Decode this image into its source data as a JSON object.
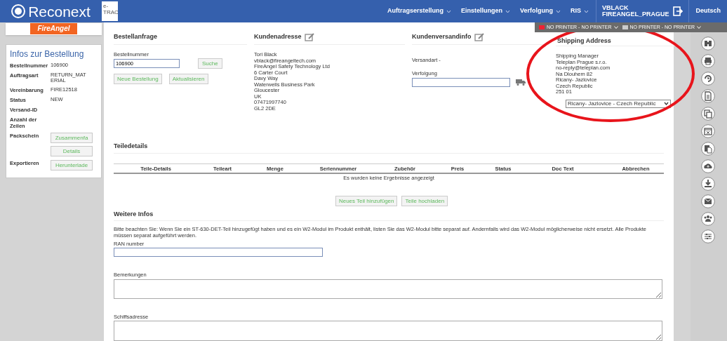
{
  "header": {
    "logo": "Reconext",
    "app_badge": "e-\nTRAC",
    "menu": [
      {
        "label": "Auftragserstellung",
        "dropdown": true
      },
      {
        "label": "Einstellungen",
        "dropdown": true
      },
      {
        "label": "Verfolgung",
        "dropdown": true
      },
      {
        "label": "RIS",
        "dropdown": true
      }
    ],
    "user": "VBLACK\nFIREANGEL_PRAGUE",
    "language": "Deutsch"
  },
  "printer_bar": [
    "NO PRINTER - NO PRINTER",
    "NO PRINTER - NO PRINTER"
  ],
  "brand_logo": "FireAngel",
  "order_info": {
    "title": "Infos zur Bestellung",
    "rows": [
      {
        "label": "Bestellnummer",
        "value": "106900"
      },
      {
        "label": "Auftragsart",
        "value": "RETURN_MAT\nERIAL"
      },
      {
        "label": "Vereinbarung",
        "value": "FIRE12518"
      },
      {
        "label": "Status",
        "value": "NEW"
      },
      {
        "label": "Versand-ID"
      },
      {
        "label": "Anzahl der Zeilen"
      },
      {
        "label": "Packschein",
        "buttons": [
          "Zusammenfa",
          "Details"
        ]
      },
      {
        "label": "Exportieren",
        "buttons": [
          "Herunterlade"
        ]
      }
    ]
  },
  "order_request": {
    "title": "Bestellanfrage",
    "field_label": "Bestellnummer",
    "field_value": "106900",
    "search_button": "Suche",
    "buttons": [
      "Neue Bestellung",
      "Aktualisieren"
    ]
  },
  "customer_address": {
    "title": "Kundenadresse",
    "lines": [
      "Tori Black",
      "vblack@fireangeltech.com",
      "FireAngel Safety Technology Ltd",
      "6 Carter Court",
      "Davy Way",
      "Waterwells Business Park",
      "Gloucester",
      "UK",
      "07471997740",
      "GL2 2DE"
    ]
  },
  "customer_shipping": {
    "title": "Kundenversandinfo",
    "shipping_method": "Versandart -",
    "tracking_label": "Verfolgung"
  },
  "shipping_address": {
    "title": "Shipping Address",
    "lines": [
      "Shipping Manager",
      "Teleplan Prague s.r.o.",
      "no-reply@teleplan.com",
      "Na Dlouhem 82",
      "Ricany- Jazlovice",
      "Czech Republic",
      "251 01"
    ],
    "select_value": "Ricany- Jazlovice - Czech Republic"
  },
  "parts": {
    "title": "Teiledetails",
    "columns": [
      "Teile-Details",
      "Teileart",
      "Menge",
      "Seriennummer",
      "Zubehör",
      "Preis",
      "Status",
      "Doc Text",
      "Abbrechen"
    ],
    "empty_message": "Es wurden keine Ergebnisse angezeigt",
    "buttons": [
      "Neues Teil hinzufügen",
      "Teile hochladen"
    ]
  },
  "more_info": {
    "title": "Weitere Infos",
    "notice": "Bitte beachten Sie: Wenn Sie ein ST-630-DET-Teil hinzugefügt haben und es ein W2-Modul im Produkt enthält, listen Sie das W2-Modul bitte separat auf. Andernfalls wird das W2-Modul möglicherweise nicht ersetzt. Alle Produkte müssen separat aufgeführt werden.",
    "fields": [
      {
        "label": "RAN number",
        "kind": "input"
      },
      {
        "label": "Bemerkungen",
        "kind": "textarea"
      },
      {
        "label": "Schiffsadresse",
        "kind": "textarea"
      }
    ]
  }
}
